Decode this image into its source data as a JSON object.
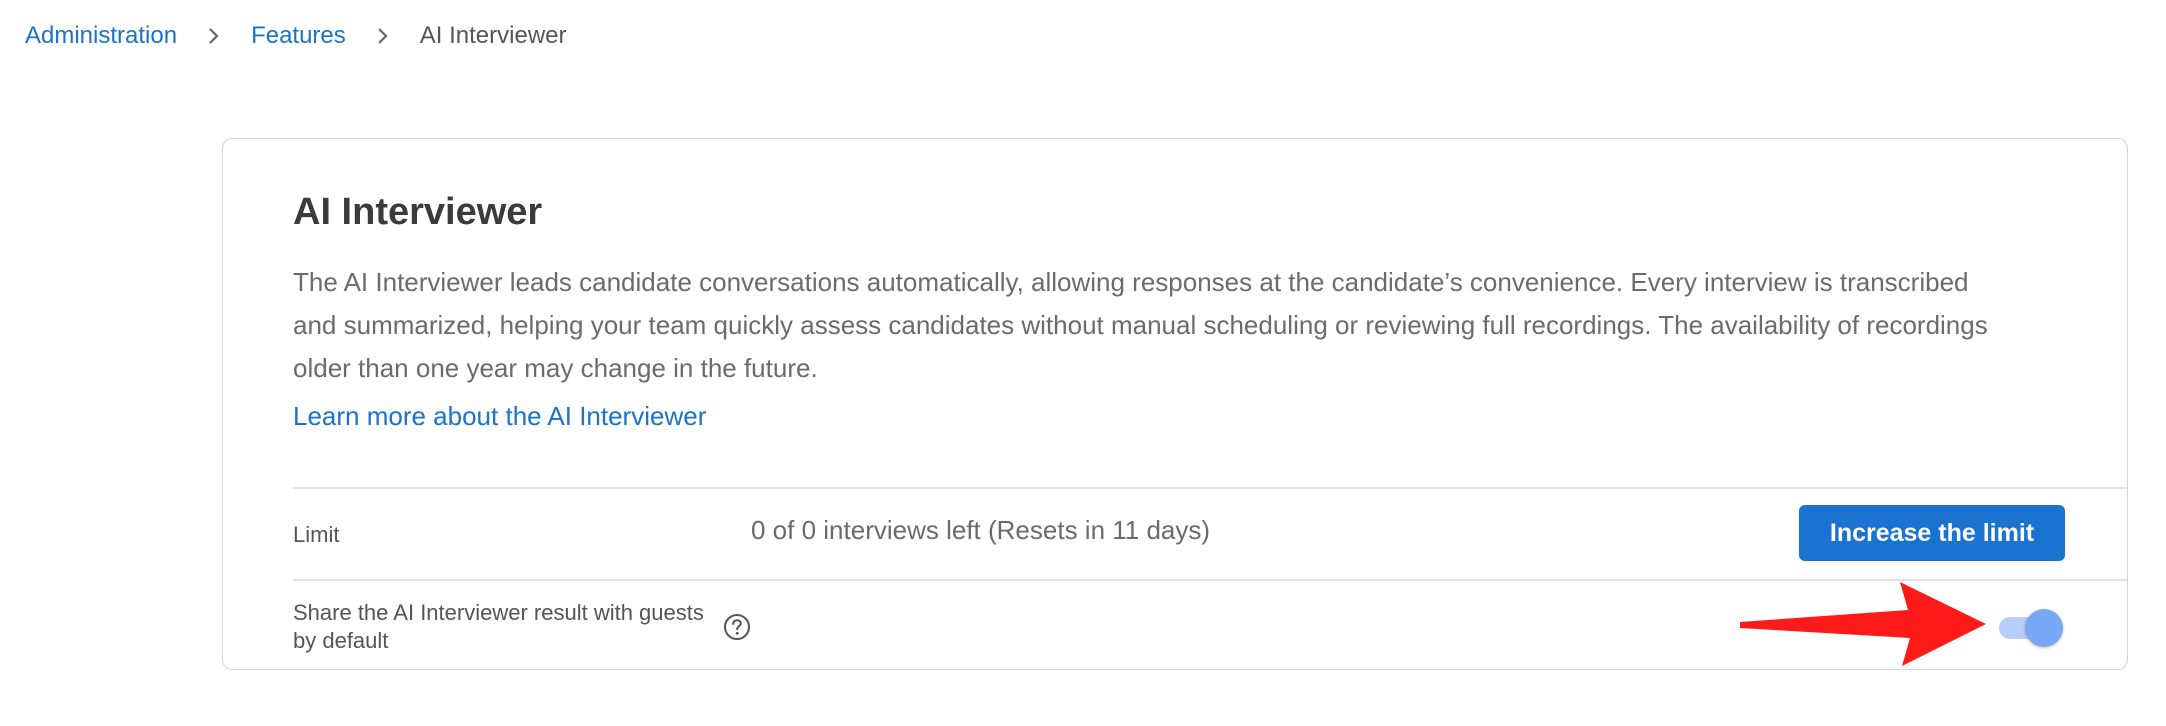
{
  "breadcrumb": {
    "items": [
      "Administration",
      "Features"
    ],
    "current": "AI Interviewer"
  },
  "card": {
    "title": "AI Interviewer",
    "description": "The AI Interviewer leads candidate conversations automatically, allowing responses at the candidate’s convenience. Every interview is transcribed and summarized, helping your team quickly assess candidates without manual scheduling or reviewing full recordings. The availability of recordings older than one year may change in the future.",
    "learn_more": "Learn more about the AI Interviewer"
  },
  "limit": {
    "label": "Limit",
    "value": "0 of 0 interviews left (Resets in 11 days)",
    "button": "Increase the limit"
  },
  "share": {
    "label": "Share the AI Interviewer result with guests by default",
    "help_icon": "question-circle-icon",
    "toggle_state": "on"
  },
  "colors": {
    "link": "#1a73c8",
    "primary_button": "#1a73d0",
    "toggle_track": "#b8cef9",
    "toggle_thumb": "#7aa7f5",
    "annotation_arrow": "#ff1a1a"
  }
}
